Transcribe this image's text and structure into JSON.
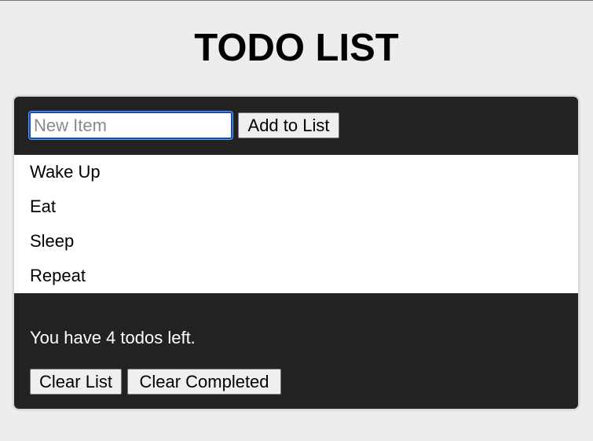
{
  "header": {
    "title": "TODO LIST"
  },
  "form": {
    "input_placeholder": "New Item",
    "input_value": "",
    "add_button_label": "Add to List"
  },
  "todos": [
    {
      "text": "Wake Up"
    },
    {
      "text": "Eat"
    },
    {
      "text": "Sleep"
    },
    {
      "text": "Repeat"
    }
  ],
  "footer": {
    "status_text": "You have 4 todos left.",
    "clear_list_label": "Clear List",
    "clear_completed_label": "Clear Completed"
  },
  "colors": {
    "page_background": "#ededed",
    "card_background": "#222222",
    "list_background": "#ffffff",
    "input_focus_border": "#0f4fb8"
  }
}
